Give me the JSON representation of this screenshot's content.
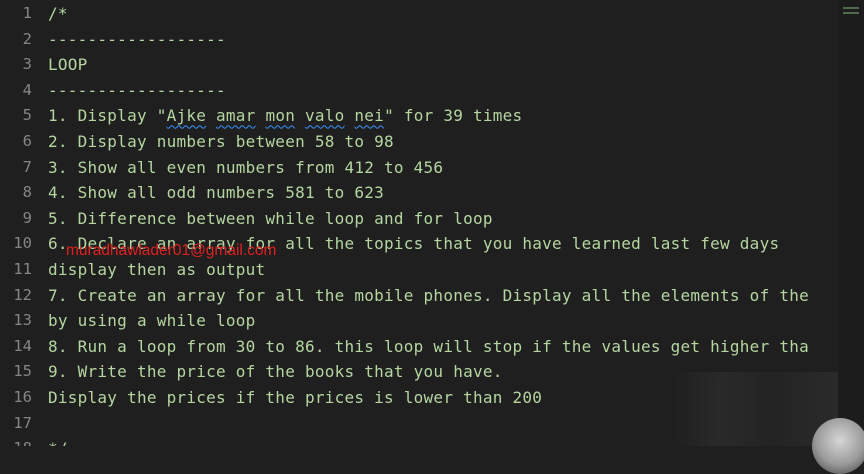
{
  "editor": {
    "lines": [
      {
        "n": "1",
        "text": "/*"
      },
      {
        "n": "2",
        "text": "------------------"
      },
      {
        "n": "3",
        "text": "LOOP"
      },
      {
        "n": "4",
        "text": "------------------"
      },
      {
        "n": "5",
        "text_before": "1. Display \"",
        "squiggle_words": [
          "Ajke",
          "amar",
          "mon",
          "valo",
          "nei"
        ],
        "text_after": "\" for 39 times"
      },
      {
        "n": "6",
        "text": "2. Display numbers between 58 to 98"
      },
      {
        "n": "7",
        "text": "3. Show all even numbers from 412 to 456"
      },
      {
        "n": "8",
        "text": "4. Show all odd numbers 581 to 623"
      },
      {
        "n": "9",
        "text": "5. Difference between while loop and for loop"
      },
      {
        "n": "10",
        "text": "6. Declare an array for all the topics that you have learned last few days"
      },
      {
        "n": "11",
        "text": "display then as output"
      },
      {
        "n": "12",
        "text": "7. Create an array for all the mobile phones. Display all the elements of the"
      },
      {
        "n": "13",
        "text": "by using a while loop"
      },
      {
        "n": "14",
        "text": "8. Run a loop from 30 to 86. this loop will stop if the values get higher tha"
      },
      {
        "n": "15",
        "text": "9. Write the price of the books that you have."
      },
      {
        "n": "16",
        "text": "Display the prices if the prices is lower than 200"
      },
      {
        "n": "17",
        "text": ""
      },
      {
        "n": "18",
        "text": "*/"
      }
    ]
  },
  "watermark": "muradhawlader01@gmail.com"
}
